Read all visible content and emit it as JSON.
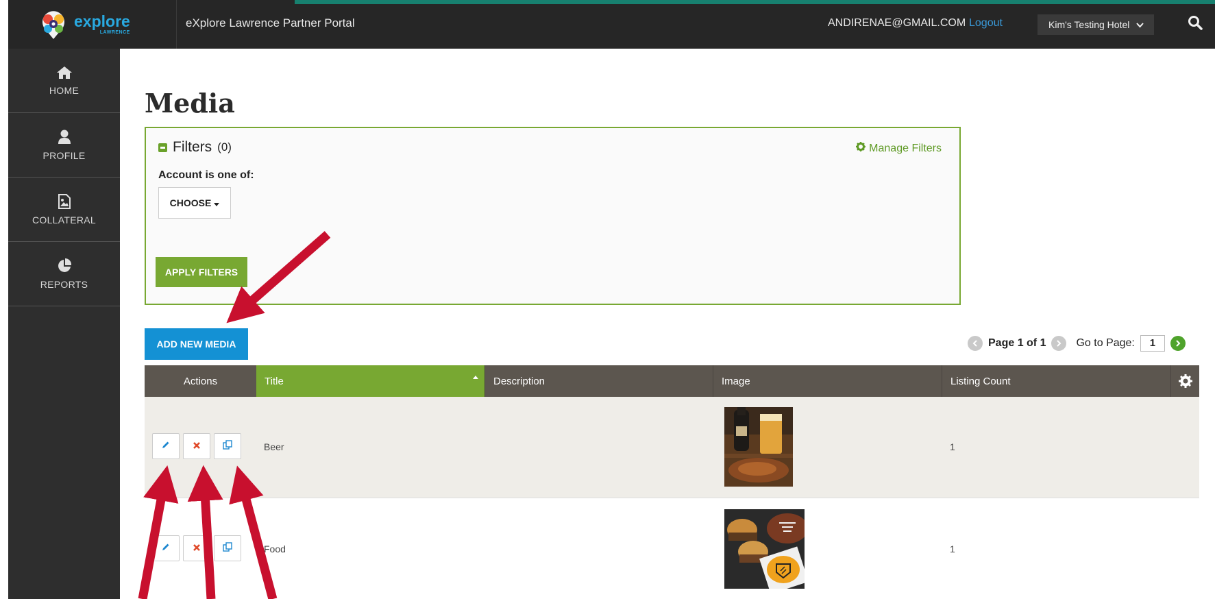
{
  "header": {
    "logo_main": "explore",
    "logo_sub": "LAWRENCE",
    "portal_title": "eXplore Lawrence Partner Portal",
    "user_email": "ANDIRENAE@GMAIL.COM",
    "logout_label": "Logout",
    "hotel_selected": "Kim's Testing Hotel"
  },
  "sidebar": {
    "items": [
      {
        "label": "HOME",
        "icon": "home-icon"
      },
      {
        "label": "PROFILE",
        "icon": "user-icon"
      },
      {
        "label": "COLLATERAL",
        "icon": "image-file-icon"
      },
      {
        "label": "REPORTS",
        "icon": "pie-chart-icon"
      }
    ]
  },
  "main": {
    "page_title": "Media",
    "filters": {
      "heading": "Filters",
      "count": "(0)",
      "manage_label": "Manage Filters",
      "account_label": "Account is one of:",
      "choose_label": "CHOOSE",
      "apply_label": "APPLY FILTERS"
    },
    "add_media_label": "ADD NEW MEDIA",
    "pager": {
      "page_text": "Page 1 of 1",
      "goto_label": "Go to Page:",
      "goto_value": "1"
    },
    "table": {
      "columns": {
        "actions": "Actions",
        "title": "Title",
        "description": "Description",
        "image": "Image",
        "listing_count": "Listing Count"
      },
      "rows": [
        {
          "title": "Beer",
          "description": "",
          "listing_count": "1"
        },
        {
          "title": "Food",
          "description": "",
          "listing_count": "1"
        }
      ]
    }
  },
  "colors": {
    "topbar": "#262626",
    "sidebar": "#2e2e2e",
    "accent_green": "#78a832",
    "accent_blue": "#1491d4",
    "annotation_arrow": "#c8102e"
  }
}
